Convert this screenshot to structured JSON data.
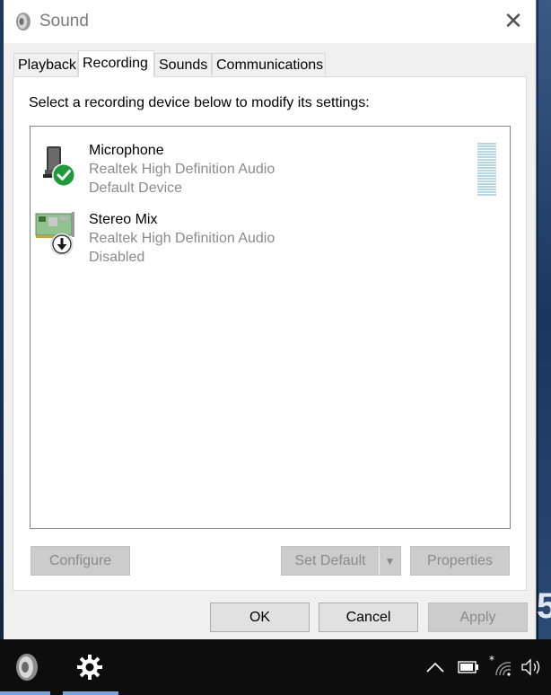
{
  "window": {
    "title": "Sound",
    "close_glyph": "✕"
  },
  "tabs": [
    {
      "label": "Playback",
      "active": false
    },
    {
      "label": "Recording",
      "active": true
    },
    {
      "label": "Sounds",
      "active": false
    },
    {
      "label": "Communications",
      "active": false
    }
  ],
  "recording": {
    "instruction": "Select a recording device below to modify its settings:",
    "devices": [
      {
        "name": "Microphone",
        "driver": "Realtek High Definition Audio",
        "status": "Default Device",
        "icon": "microphone-icon",
        "badge": "checkmark-badge-icon",
        "has_level_meter": true
      },
      {
        "name": "Stereo Mix",
        "driver": "Realtek High Definition Audio",
        "status": "Disabled",
        "icon": "sound-card-icon",
        "badge": "disabled-arrow-badge-icon"
      }
    ],
    "buttons": {
      "configure": "Configure",
      "set_default": "Set Default",
      "set_default_arrow": "▼",
      "properties": "Properties"
    }
  },
  "footer": {
    "ok": "OK",
    "cancel": "Cancel",
    "apply": "Apply"
  },
  "taskbar": {
    "apps": [
      "speaker-app-icon",
      "settings-gear-icon"
    ],
    "tray": [
      "chevron-up-icon",
      "battery-icon",
      "wifi-icon",
      "volume-icon"
    ]
  },
  "desktop": {
    "glyph": "5"
  },
  "colors": {
    "accent_check": "#1e9a3a",
    "level_meter": "#b5d7e6",
    "taskbar_underline": "#7aa3d8"
  }
}
